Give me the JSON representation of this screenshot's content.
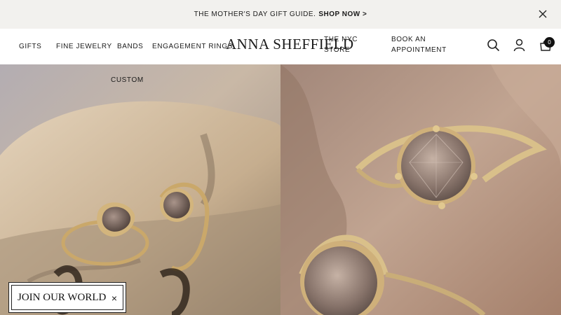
{
  "announcement": {
    "text": "THE MOTHER'S DAY GIFT GUIDE.",
    "link": "SHOP NOW >"
  },
  "nav": {
    "gifts": "GIFTS",
    "fine_jewelry": "FINE JEWELRY",
    "bands": "BANDS",
    "engagement": "ENGAGEMENT RINGS",
    "nyc_store_1": "THE NYC",
    "nyc_store_2": "STORE",
    "appointment_1": "BOOK AN",
    "appointment_2": "APPOINTMENT",
    "custom": "CUSTOM"
  },
  "logo": "ANNA SHEFFIELD",
  "cart": {
    "count": "0"
  },
  "popup": {
    "label": "JOIN OUR WORLD",
    "close": "×"
  },
  "icons": [
    "close-icon",
    "search-icon",
    "account-icon",
    "cart-icon"
  ]
}
